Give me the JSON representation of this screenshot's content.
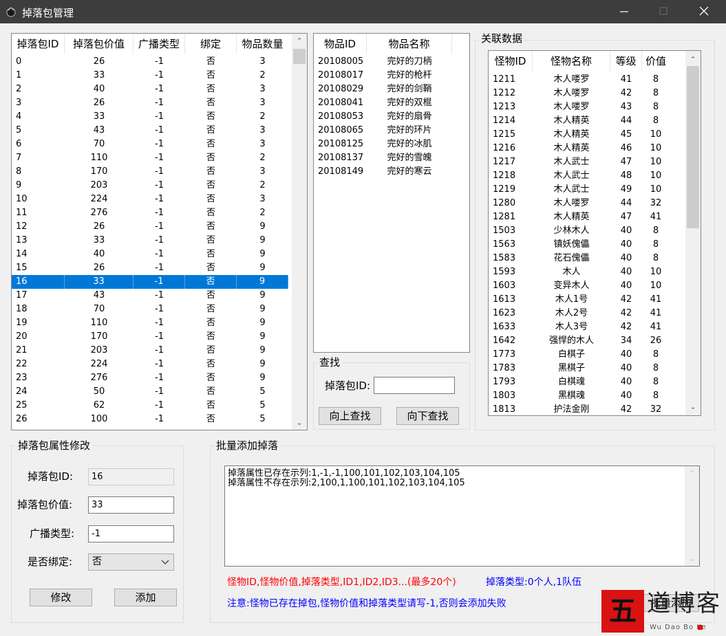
{
  "window": {
    "title": "掉落包管理"
  },
  "drop_list": {
    "headers": [
      "掉落包ID",
      "掉落包价值",
      "广播类型",
      "绑定",
      "物品数量"
    ],
    "rows": [
      [
        "0",
        "26",
        "-1",
        "否",
        "3"
      ],
      [
        "1",
        "33",
        "-1",
        "否",
        "2"
      ],
      [
        "2",
        "40",
        "-1",
        "否",
        "3"
      ],
      [
        "3",
        "26",
        "-1",
        "否",
        "3"
      ],
      [
        "4",
        "33",
        "-1",
        "否",
        "2"
      ],
      [
        "5",
        "43",
        "-1",
        "否",
        "3"
      ],
      [
        "6",
        "70",
        "-1",
        "否",
        "3"
      ],
      [
        "7",
        "110",
        "-1",
        "否",
        "2"
      ],
      [
        "8",
        "170",
        "-1",
        "否",
        "3"
      ],
      [
        "9",
        "203",
        "-1",
        "否",
        "2"
      ],
      [
        "10",
        "224",
        "-1",
        "否",
        "3"
      ],
      [
        "11",
        "276",
        "-1",
        "否",
        "2"
      ],
      [
        "12",
        "26",
        "-1",
        "否",
        "9"
      ],
      [
        "13",
        "33",
        "-1",
        "否",
        "9"
      ],
      [
        "14",
        "40",
        "-1",
        "否",
        "9"
      ],
      [
        "15",
        "26",
        "-1",
        "否",
        "9"
      ],
      [
        "16",
        "33",
        "-1",
        "否",
        "9"
      ],
      [
        "17",
        "43",
        "-1",
        "否",
        "9"
      ],
      [
        "18",
        "70",
        "-1",
        "否",
        "9"
      ],
      [
        "19",
        "110",
        "-1",
        "否",
        "9"
      ],
      [
        "20",
        "170",
        "-1",
        "否",
        "9"
      ],
      [
        "21",
        "203",
        "-1",
        "否",
        "9"
      ],
      [
        "22",
        "224",
        "-1",
        "否",
        "9"
      ],
      [
        "23",
        "276",
        "-1",
        "否",
        "9"
      ],
      [
        "24",
        "50",
        "-1",
        "否",
        "5"
      ],
      [
        "25",
        "62",
        "-1",
        "否",
        "5"
      ],
      [
        "26",
        "100",
        "-1",
        "否",
        "5"
      ]
    ],
    "selected_index": 16
  },
  "item_list": {
    "headers": [
      "物品ID",
      "物品名称"
    ],
    "rows": [
      [
        "20108005",
        "完好的刀柄"
      ],
      [
        "20108017",
        "完好的枪杆"
      ],
      [
        "20108029",
        "完好的剑鞘"
      ],
      [
        "20108041",
        "完好的双棍"
      ],
      [
        "20108053",
        "完好的扇骨"
      ],
      [
        "20108065",
        "完好的环片"
      ],
      [
        "20108125",
        "完好的冰肌"
      ],
      [
        "20108137",
        "完好的雪魄"
      ],
      [
        "20108149",
        "完好的寒云"
      ]
    ]
  },
  "search": {
    "group_label": "查找",
    "id_label": "掉落包ID:",
    "id_value": "",
    "up_button": "向上查找",
    "down_button": "向下查找"
  },
  "related": {
    "group_label": "关联数据",
    "headers": [
      "怪物ID",
      "怪物名称",
      "等级",
      "价值"
    ],
    "rows": [
      [
        "1211",
        "木人喽罗",
        "41",
        "8"
      ],
      [
        "1212",
        "木人喽罗",
        "42",
        "8"
      ],
      [
        "1213",
        "木人喽罗",
        "43",
        "8"
      ],
      [
        "1214",
        "木人精英",
        "44",
        "8"
      ],
      [
        "1215",
        "木人精英",
        "45",
        "10"
      ],
      [
        "1216",
        "木人精英",
        "46",
        "10"
      ],
      [
        "1217",
        "木人武士",
        "47",
        "10"
      ],
      [
        "1218",
        "木人武士",
        "48",
        "10"
      ],
      [
        "1219",
        "木人武士",
        "49",
        "10"
      ],
      [
        "1280",
        "木人喽罗",
        "44",
        "32"
      ],
      [
        "1281",
        "木人精英",
        "47",
        "41"
      ],
      [
        "1503",
        "少林木人",
        "40",
        "8"
      ],
      [
        "1563",
        "镇妖傀儡",
        "40",
        "8"
      ],
      [
        "1583",
        "花石傀儡",
        "40",
        "8"
      ],
      [
        "1593",
        "木人",
        "40",
        "10"
      ],
      [
        "1603",
        "变异木人",
        "40",
        "10"
      ],
      [
        "1613",
        "木人1号",
        "42",
        "41"
      ],
      [
        "1623",
        "木人2号",
        "42",
        "41"
      ],
      [
        "1633",
        "木人3号",
        "42",
        "41"
      ],
      [
        "1642",
        "强悍的木人",
        "34",
        "26"
      ],
      [
        "1773",
        "白棋子",
        "40",
        "8"
      ],
      [
        "1783",
        "黑棋子",
        "40",
        "8"
      ],
      [
        "1793",
        "白棋魂",
        "40",
        "8"
      ],
      [
        "1803",
        "黑棋魂",
        "40",
        "8"
      ],
      [
        "1813",
        "护法金刚",
        "42",
        "32"
      ]
    ]
  },
  "edit": {
    "group_label": "掉落包属性修改",
    "id_label": "掉落包ID:",
    "id_value": "16",
    "value_label": "掉落包价值:",
    "value_value": "33",
    "broadcast_label": "广播类型:",
    "broadcast_value": "-1",
    "bind_label": "是否绑定:",
    "bind_value": "否",
    "modify_button": "修改",
    "add_button": "添加"
  },
  "batch": {
    "group_label": "批量添加掉落",
    "lines": [
      "掉落属性已存在示列:1,-1,-1,100,101,102,103,104,105",
      "掉落属性不存在示列:2,100,1,100,101,102,103,104,105"
    ],
    "format_text": "怪物ID,怪物价值,掉落类型,ID1,ID2,ID3...(最多20个)",
    "type_text": "掉落类型:0个人,1队伍",
    "notice_text": "注意:怪物已存在掉包,怪物价值和掉落类型请写-1,否则会添加失败",
    "batch_button": "批量添加",
    "colors": {
      "format": "#ff0000",
      "type": "#0000ff",
      "notice": "#0000ff"
    }
  },
  "watermark": {
    "char": "五",
    "text": "道博客",
    "sub": "Wu Dao Bo Ke"
  }
}
